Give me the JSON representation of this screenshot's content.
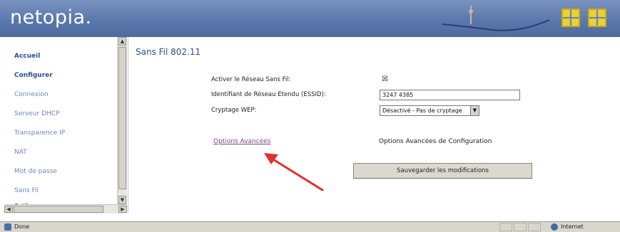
{
  "header": {
    "logo_text": "netopia."
  },
  "sidebar": {
    "items": [
      {
        "label": "Accueil",
        "bold": true
      },
      {
        "label": "Configurer",
        "bold": true
      },
      {
        "label": "Connexion",
        "bold": false
      },
      {
        "label": "Serveur DHCP",
        "bold": false
      },
      {
        "label": "Transparence IP",
        "bold": false
      },
      {
        "label": "NAT",
        "bold": false
      },
      {
        "label": "Mot de passe",
        "bold": false
      },
      {
        "label": "Sans Fil",
        "bold": false
      },
      {
        "label": "Outils",
        "bold": true
      }
    ]
  },
  "main": {
    "title": "Sans Fil 802.11",
    "form": {
      "enable_label": "Activer le Réseau Sans Fil:",
      "enable_checked": true,
      "ssid_label": "Identifiant de Réseau Etendu (ESSID):",
      "ssid_value": "3247 4385",
      "wep_label": "Cryptage WEP:",
      "wep_value": "Désactivé - Pas de cryptage"
    },
    "advanced_link": "Options Avancées",
    "advanced_desc": "Options Avancées de Configuration",
    "save_button": "Sauvegarder les modifications"
  },
  "statusbar": {
    "status": "Done",
    "zone": "Internet"
  },
  "colors": {
    "header": "#5b78ad",
    "nav_bold": "#2d4f8f",
    "nav_link": "#6f86b6",
    "annotation_arrow": "#e03030"
  }
}
